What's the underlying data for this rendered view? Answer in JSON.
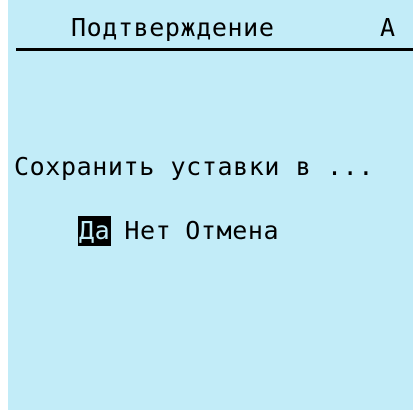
{
  "header": {
    "title": "Подтверждение",
    "extra": "А"
  },
  "dialog": {
    "message": "Сохранить уставки в ...",
    "options": [
      {
        "label": "Да",
        "selected": true
      },
      {
        "label": "Нет",
        "selected": false
      },
      {
        "label": "Отмена",
        "selected": false
      }
    ]
  },
  "colors": {
    "screen_background": "#c2ecf8",
    "text": "#000000",
    "selection_background": "#000000"
  }
}
